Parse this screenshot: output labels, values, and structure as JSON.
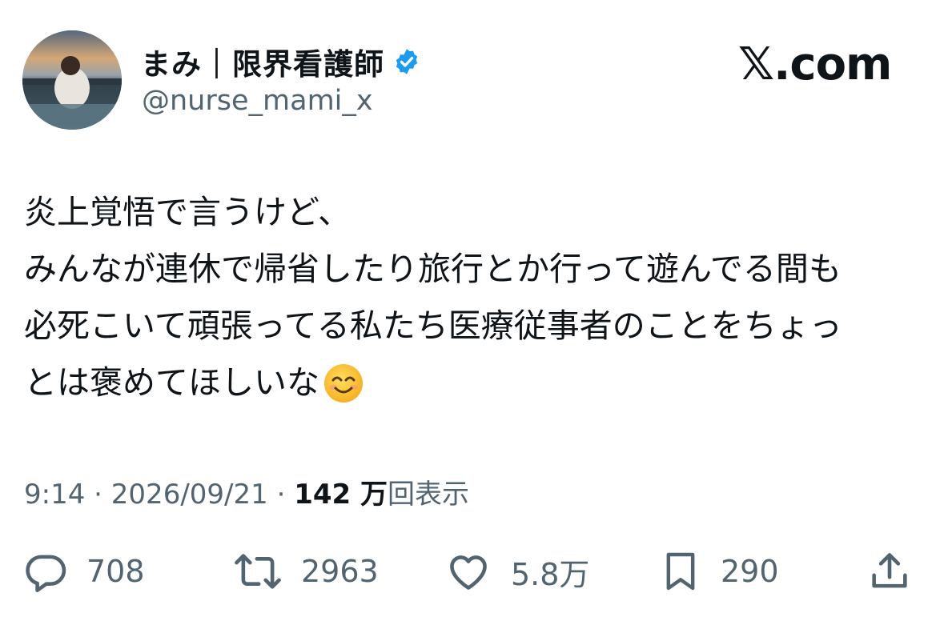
{
  "author": {
    "display_name": "まみ｜限界看護師",
    "handle": "@nurse_mami_x",
    "verified_icon": "verified-badge-icon",
    "badge_color": "#1d9bf0"
  },
  "brand": {
    "watermark": "𝕏.com"
  },
  "tweet": {
    "lines": [
      "炎上覚悟で言うけど、",
      "みんなが連休で帰省したり旅行とか行って遊んでる間も",
      "必死こいて頑張ってる私たち医療従事者のことをちょっ",
      "とは褒めてほしいな"
    ],
    "emoji": "smiling-face-emoji"
  },
  "meta": {
    "time": "9:14",
    "separator": " · ",
    "date": "2026/09/21",
    "views_count": "142 万",
    "views_label": "回表示"
  },
  "actions": {
    "reply": {
      "icon": "reply-icon",
      "count": "708"
    },
    "retweet": {
      "icon": "retweet-icon",
      "count": "2963"
    },
    "like": {
      "icon": "heart-icon",
      "count": "5.8万"
    },
    "bookmark": {
      "icon": "bookmark-icon",
      "count": "290"
    },
    "share": {
      "icon": "share-icon"
    }
  },
  "colors": {
    "text": "#0f1419",
    "secondary": "#536471",
    "emoji_face": "#ffc83d"
  }
}
